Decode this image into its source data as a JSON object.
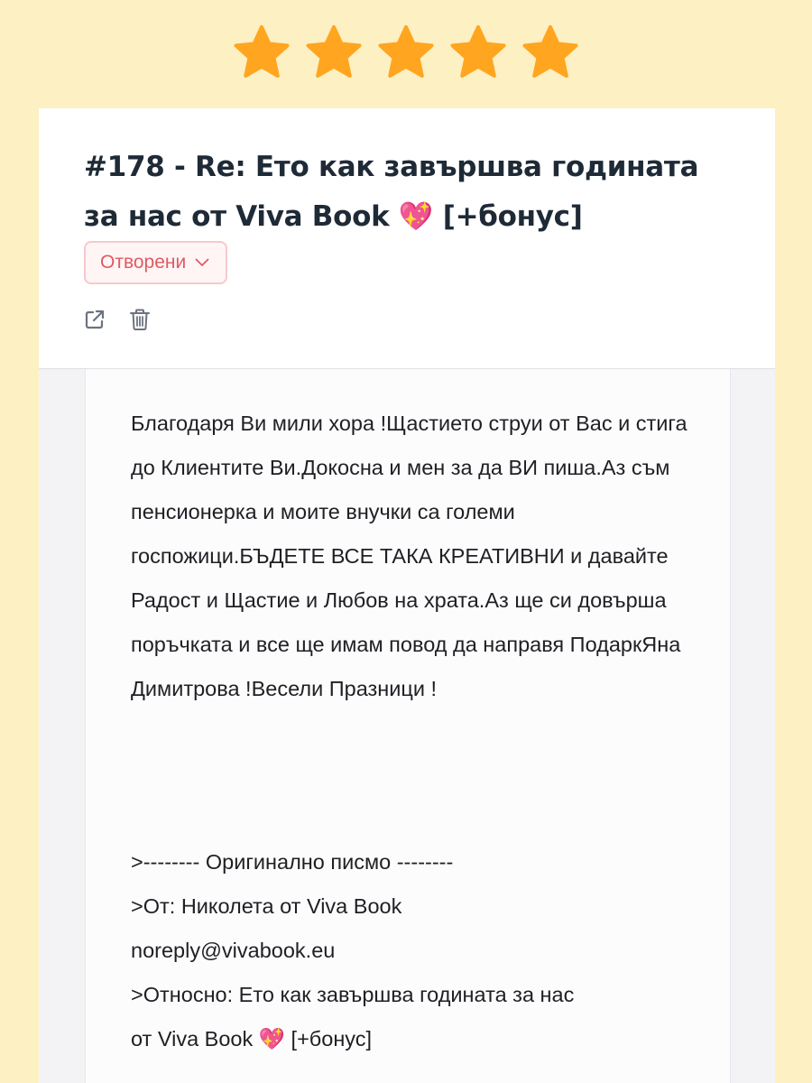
{
  "rating": {
    "stars": 5,
    "max": 5,
    "color": "#ffa51f"
  },
  "ticket": {
    "title": "#178 - Re: Ето как завършва годината за нас от Viva Book 💖 [+бонус]",
    "status_label": "Отворени",
    "status_color": "#e05a62",
    "actions": [
      "external-link-icon",
      "trash-icon"
    ]
  },
  "message": {
    "body": "Благодаря Ви мили хора !Щастието струи от Вас и стига до Клиентите Ви.Докосна и мен за да ВИ пиша.Аз съм пенсионерка и моите внучки са големи госпожици.БЪДЕТЕ ВСЕ ТАКА КРЕАТИВНИ и давайте Радост и Щастие и Любов на храта.Аз ще си довърша поръчката и все ще имам повод да направя ПодаркЯна Димитрова !Весели Празници !",
    "original_header": ">-------- Оригинално писмо --------",
    "from_line": ">От: Николета от Viva Book",
    "from_email": "noreply@vivabook.eu",
    "subject_line_1": ">Относно: Ето как завършва годината за нас",
    "subject_line_2": "от Viva Book 💖 [+бонус]"
  }
}
